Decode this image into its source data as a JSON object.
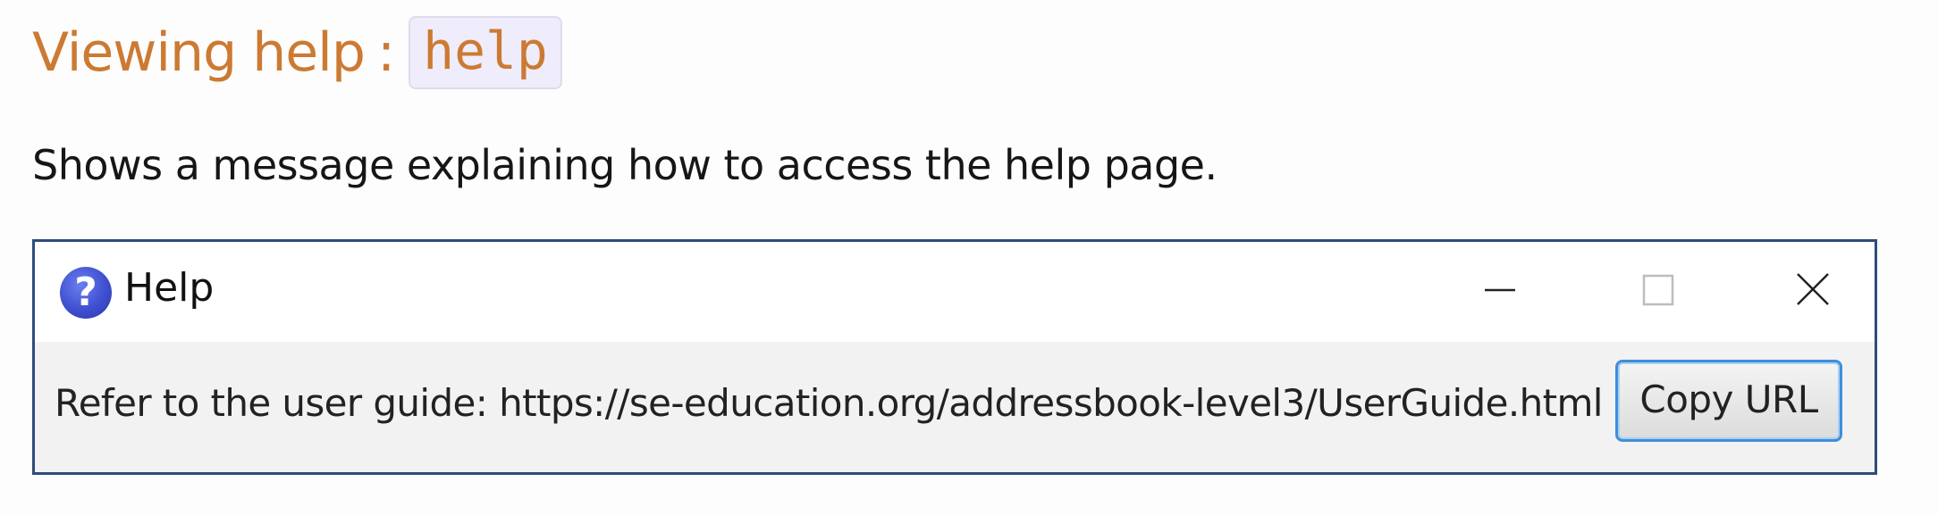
{
  "heading": {
    "text": "Viewing help",
    "separator": ":",
    "command": "help"
  },
  "description": "Shows a message explaining how to access the help page.",
  "help_window": {
    "title": "Help",
    "icon": "question-mark-icon",
    "message": "Refer to the user guide: https://se-education.org/addressbook-level3/UserGuide.html",
    "copy_button_label": "Copy URL",
    "controls": [
      "minimize-icon",
      "maximize-icon",
      "close-icon"
    ]
  },
  "colors": {
    "heading": "#cc7a33",
    "window_border": "#2f4c7a",
    "button_focus": "#3d8fd9",
    "help_icon": "#3f4fd0"
  }
}
